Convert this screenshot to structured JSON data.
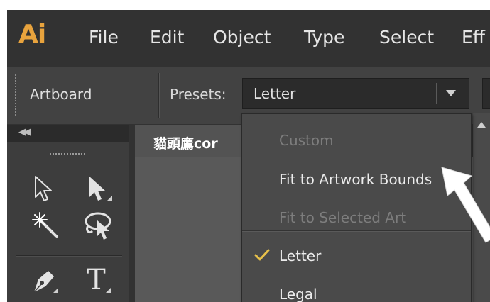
{
  "app": {
    "logo": "Ai",
    "logo_color": "#E8A33D"
  },
  "menubar": {
    "items": [
      {
        "label": "File"
      },
      {
        "label": "Edit"
      },
      {
        "label": "Object"
      },
      {
        "label": "Type"
      },
      {
        "label": "Select"
      },
      {
        "label": "Eff"
      }
    ]
  },
  "controlbar": {
    "artboard_label": "Artboard",
    "presets_label": "Presets:",
    "presets_value": "Letter"
  },
  "document": {
    "tab_label": "貓頭鷹cor"
  },
  "dropdown": {
    "items": [
      {
        "label": "Custom",
        "enabled": false
      },
      {
        "label": "Fit to Artwork Bounds",
        "enabled": true
      },
      {
        "label": "Fit to Selected Art",
        "enabled": false
      },
      {
        "label": "Letter",
        "enabled": true,
        "checked": true
      },
      {
        "label": "Legal",
        "enabled": true
      }
    ]
  },
  "icons": {
    "tools": [
      "selection-tool-icon",
      "direct-selection-tool-icon",
      "magic-wand-tool-icon",
      "lasso-tool-icon",
      "pen-tool-icon",
      "type-tool-icon"
    ],
    "collapse": "double-chevron-left-icon",
    "check": "checkmark-icon",
    "dropdown": "triangle-down-icon"
  },
  "colors": {
    "ui_background": "#323232",
    "menu_background": "#4a4a4a",
    "check": "#E8C14A"
  }
}
